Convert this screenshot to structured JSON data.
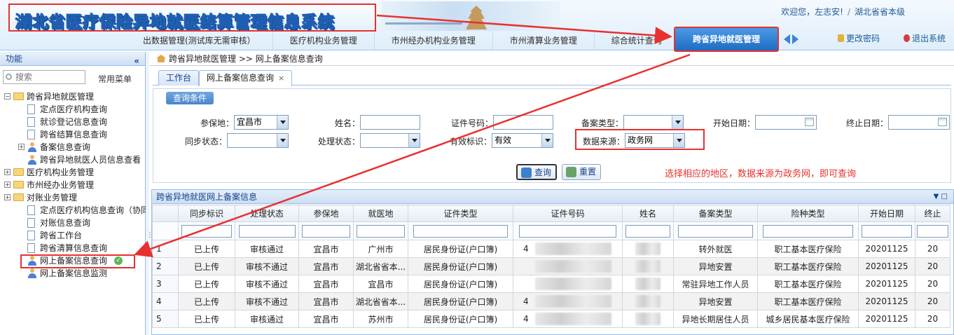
{
  "header": {
    "logo_text": "湖北省医疗保险异地就医结算管理信息系统",
    "welcome": "欢迎您，左志安!",
    "region": "湖北省省本级"
  },
  "topnav": {
    "items": [
      "出数据管理(测试库无需审核）",
      "医疗机构业务管理",
      "市州经办机构业务管理",
      "市州清算业务管理",
      "综合统计查询"
    ],
    "active": "跨省异地就医管理",
    "change_password": "更改密码",
    "logout": "退出系统"
  },
  "sidebar": {
    "title": "功能",
    "collapse": "«",
    "search_placeholder": "搜索",
    "common_menu": "常用菜单",
    "tree": [
      {
        "label": "跨省异地就医管理",
        "level": 0,
        "type": "folder",
        "expand": "−"
      },
      {
        "label": "定点医疗机构查询",
        "level": 1,
        "type": "doc"
      },
      {
        "label": "就诊登记信息查询",
        "level": 1,
        "type": "doc"
      },
      {
        "label": "跨省结算信息查询",
        "level": 1,
        "type": "doc"
      },
      {
        "label": "备案信息查询",
        "level": 1,
        "type": "person",
        "expand": "+"
      },
      {
        "label": "跨省异地就医人员信息查看",
        "level": 1,
        "type": "person"
      },
      {
        "label": "医疗机构业务管理",
        "level": 0,
        "type": "folder",
        "expand": "+"
      },
      {
        "label": "市州经办业务管理",
        "level": 0,
        "type": "folder",
        "expand": "+"
      },
      {
        "label": "对账业务管理",
        "level": 0,
        "type": "folder",
        "expand": "+"
      },
      {
        "label": "定点医疗机构信息查询（协同",
        "level": 1,
        "type": "doc"
      },
      {
        "label": "对账信息查询",
        "level": 1,
        "type": "doc"
      },
      {
        "label": "跨省工作台",
        "level": 1,
        "type": "doc"
      },
      {
        "label": "跨省清算信息查询",
        "level": 1,
        "type": "doc"
      },
      {
        "label": "网上备案信息查询",
        "level": 1,
        "type": "person",
        "active": true
      },
      {
        "label": "网上备案信息监测",
        "level": 1,
        "type": "person"
      }
    ]
  },
  "breadcrumb": {
    "section": "跨省异地就医管理",
    "sep": ">>",
    "page": "网上备案信息查询"
  },
  "tabs": [
    {
      "label": "工作台"
    },
    {
      "label": "网上备案信息查询",
      "close": "×"
    }
  ],
  "query": {
    "title": "查询条件",
    "fields": {
      "insured_place": {
        "label": "参保地：",
        "value": "宜昌市"
      },
      "name": {
        "label": "姓名：",
        "value": ""
      },
      "id_no": {
        "label": "证件号码：",
        "value": ""
      },
      "record_type": {
        "label": "备案类型：",
        "value": ""
      },
      "start_date": {
        "label": "开始日期：",
        "value": ""
      },
      "end_date": {
        "label": "终止日期：",
        "value": ""
      },
      "sync_status": {
        "label": "同步状态：",
        "value": ""
      },
      "process_status": {
        "label": "处理状态：",
        "value": ""
      },
      "valid_flag": {
        "label": "有效标识：",
        "value": "有效"
      },
      "data_source": {
        "label": "数据来源：",
        "value": "政务网"
      }
    },
    "buttons": {
      "query": "查询",
      "reset": "重置"
    },
    "hint": "选择相应的地区，数据来源为政务网，即可查询"
  },
  "grid": {
    "title": "跨省异地就医网上备案信息",
    "tools": "▼ □",
    "columns": [
      "",
      "同步标识",
      "处理状态",
      "参保地",
      "就医地",
      "证件类型",
      "证件号码",
      "姓名",
      "备案类型",
      "险种类型",
      "开始日期",
      "终止"
    ],
    "rows": [
      [
        "1",
        "已上传",
        "审核通过",
        "宜昌市",
        "广州市",
        "居民身份证(户口簿)",
        "4",
        "",
        "转外就医",
        "职工基本医疗保险",
        "20201125",
        "20"
      ],
      [
        "2",
        "已上传",
        "审核不通过",
        "宜昌市",
        "湖北省省本...",
        "居民身份证(户口簿)",
        "",
        "",
        "异地安置",
        "职工基本医疗保险",
        "20201125",
        "20"
      ],
      [
        "3",
        "已上传",
        "审核不通过",
        "宜昌市",
        "宜昌市",
        "居民身份证(户口簿)",
        "",
        "",
        "常驻异地工作人员",
        "职工基本医疗保险",
        "20201125",
        "20"
      ],
      [
        "4",
        "已上传",
        "审核不通过",
        "宜昌市",
        "湖北省省本...",
        "居民身份证(户口簿)",
        "4",
        "",
        "异地安置",
        "职工基本医疗保险",
        "20201125",
        "20"
      ],
      [
        "5",
        "已上传",
        "审核通过",
        "宜昌市",
        "苏州市",
        "居民身份证(户口簿)",
        "4",
        "",
        "异地长期居住人员",
        "城乡居民基本医疗保险",
        "20201125",
        "20"
      ]
    ]
  },
  "colors": {
    "accent": "#1f6cc2",
    "annotation": "#e8312f",
    "header_text": "#15428b"
  }
}
